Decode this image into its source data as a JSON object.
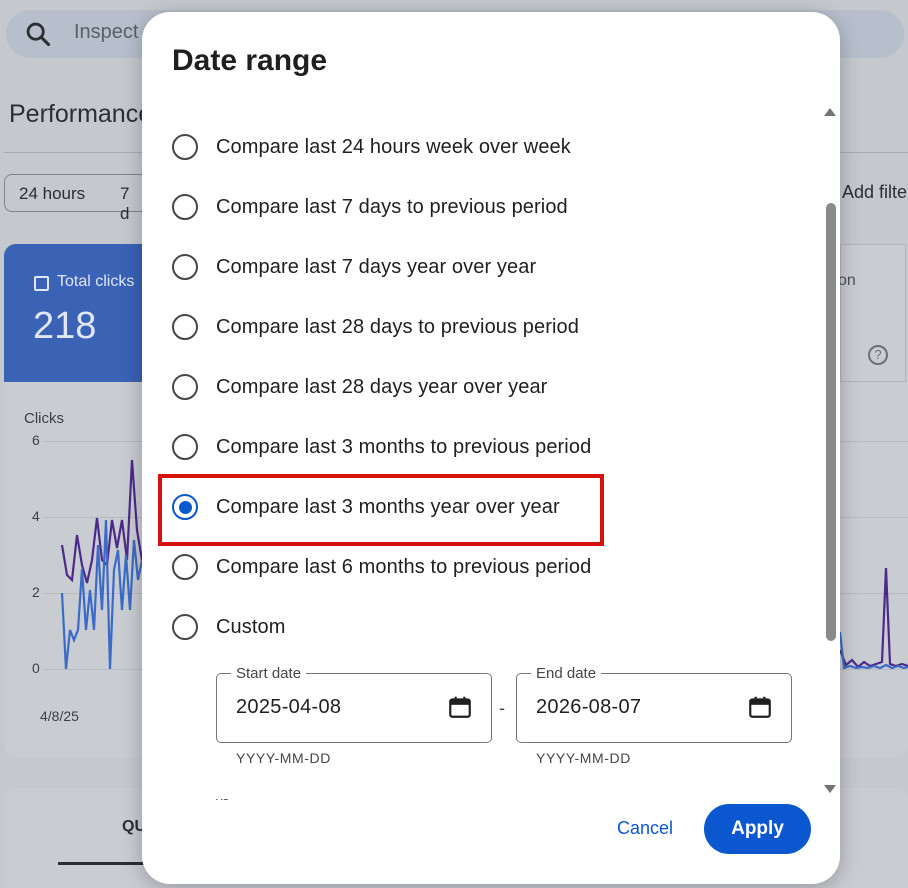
{
  "background": {
    "search_placeholder": "Inspect",
    "page_title": "Performance",
    "chips": [
      "24 hours",
      "7 d"
    ],
    "add_filter": "Add filte",
    "card_label": "Total clicks",
    "card_value": "218",
    "card_right_partial": "on",
    "help_symbol": "?",
    "chart_ylabel": "Clicks",
    "y_ticks": [
      "6",
      "4",
      "2",
      "0"
    ],
    "x_tick": "4/8/25",
    "bottom_tab": "QU",
    "colors": {
      "primary": "#0b57d0",
      "highlight": "#d6120f"
    }
  },
  "dialog": {
    "title": "Date range",
    "options": [
      {
        "label": "Compare last 24 hours week over week",
        "checked": false
      },
      {
        "label": "Compare last 7 days to previous period",
        "checked": false
      },
      {
        "label": "Compare last 7 days year over year",
        "checked": false
      },
      {
        "label": "Compare last 28 days to previous period",
        "checked": false
      },
      {
        "label": "Compare last 28 days year over year",
        "checked": false
      },
      {
        "label": "Compare last 3 months to previous period",
        "checked": false
      },
      {
        "label": "Compare last 3 months year over year",
        "checked": true
      },
      {
        "label": "Compare last 6 months to previous period",
        "checked": false
      },
      {
        "label": "Custom",
        "checked": false
      }
    ],
    "start_date": {
      "label": "Start date",
      "value": "2025-04-08",
      "hint": "YYYY-MM-DD"
    },
    "separator": "-",
    "end_date": {
      "label": "End date",
      "value": "2026-08-07",
      "hint": "YYYY-MM-DD"
    },
    "vs_partial": "vs",
    "cancel_label": "Cancel",
    "apply_label": "Apply"
  }
}
